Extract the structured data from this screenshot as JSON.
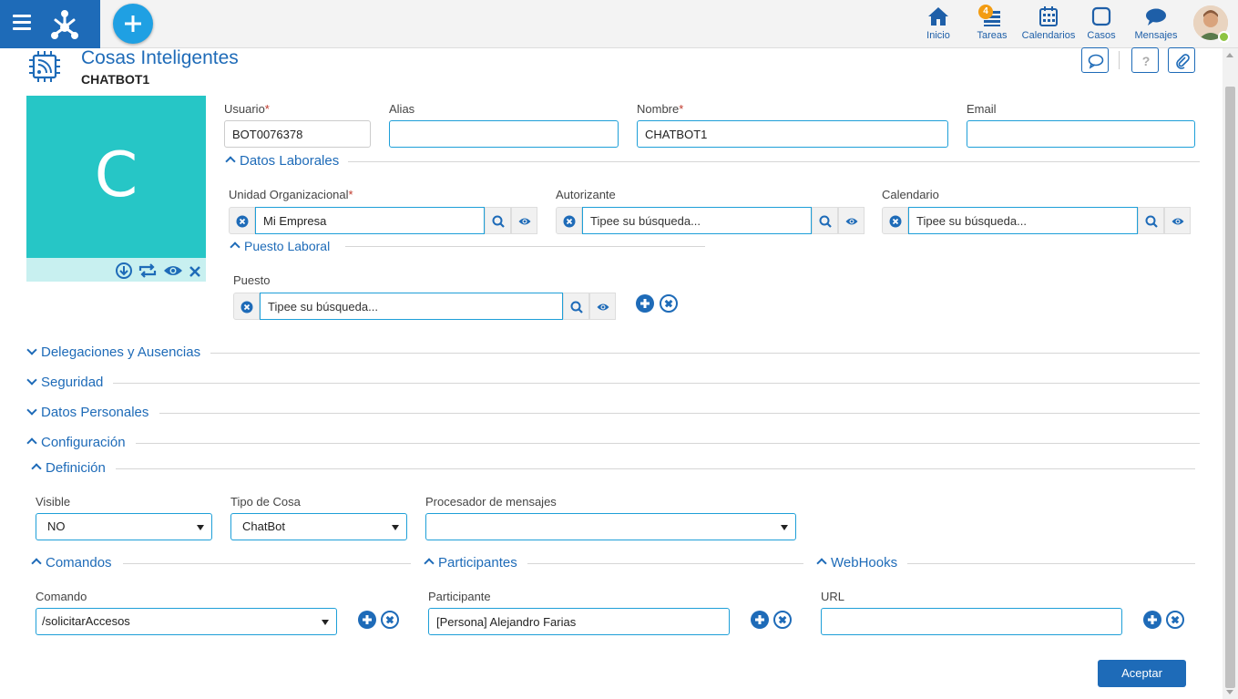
{
  "header": {
    "nav": [
      {
        "label": "Inicio",
        "icon": "home-icon"
      },
      {
        "label": "Tareas",
        "icon": "tasks-icon",
        "badge": "4"
      },
      {
        "label": "Calendarios",
        "icon": "calendar-icon"
      },
      {
        "label": "Casos",
        "icon": "cases-icon"
      },
      {
        "label": "Mensajes",
        "icon": "messages-icon"
      }
    ]
  },
  "page": {
    "title": "Cosas Inteligentes",
    "subtitle": "CHATBOT1",
    "photo_letter": "C"
  },
  "fields": {
    "usuario": {
      "label": "Usuario",
      "value": "BOT0076378"
    },
    "alias": {
      "label": "Alias",
      "value": ""
    },
    "nombre": {
      "label": "Nombre",
      "value": "CHATBOT1"
    },
    "email": {
      "label": "Email",
      "value": ""
    }
  },
  "datos_laborales": {
    "title": "Datos Laborales",
    "unidad": {
      "label": "Unidad Organizacional",
      "value": "Mi Empresa"
    },
    "autorizante": {
      "label": "Autorizante",
      "placeholder": "Tipee su búsqueda..."
    },
    "calendario": {
      "label": "Calendario",
      "placeholder": "Tipee su búsqueda..."
    },
    "puesto_laboral": {
      "title": "Puesto Laboral",
      "puesto": {
        "label": "Puesto",
        "placeholder": "Tipee su búsqueda..."
      }
    }
  },
  "sections": {
    "delegaciones": "Delegaciones y Ausencias",
    "seguridad": "Seguridad",
    "datos_personales": "Datos Personales",
    "configuracion": "Configuración",
    "definicion": "Definición"
  },
  "definicion": {
    "visible": {
      "label": "Visible",
      "value": "NO"
    },
    "tipo": {
      "label": "Tipo de Cosa",
      "value": "ChatBot"
    },
    "procesador": {
      "label": "Procesador de mensajes",
      "value": ""
    }
  },
  "comandos": {
    "title": "Comandos",
    "label": "Comando",
    "value": "/solicitarAccesos"
  },
  "participantes": {
    "title": "Participantes",
    "label": "Participante",
    "value": "[Persona] Alejandro Farias"
  },
  "webhooks": {
    "title": "WebHooks",
    "label": "URL",
    "value": ""
  },
  "footer": {
    "accept_label": "Aceptar"
  },
  "colors": {
    "primary": "#1e6bb8",
    "photo_bg": "#26c6c6",
    "badge": "#f39c12"
  }
}
